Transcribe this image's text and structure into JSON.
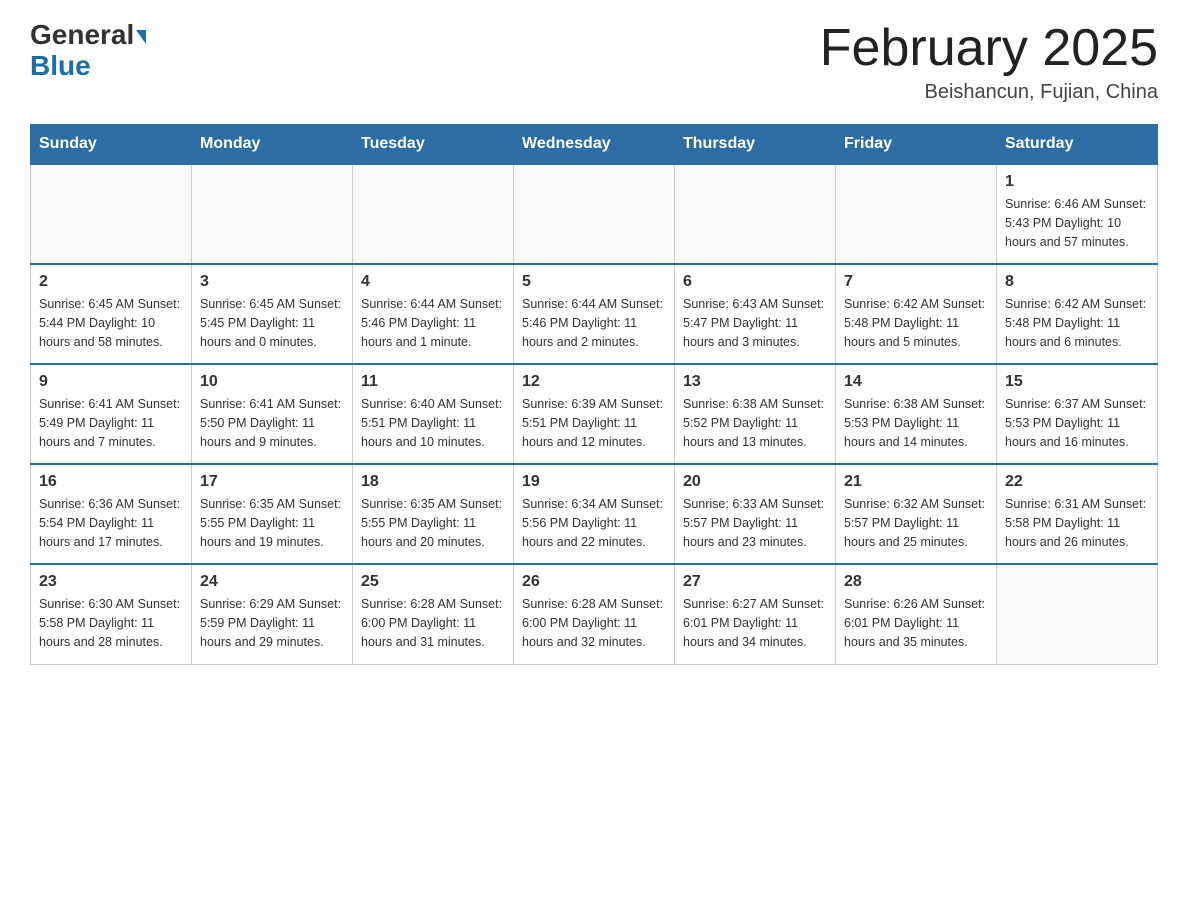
{
  "header": {
    "logo_line1": "General",
    "logo_line2": "Blue",
    "calendar_title": "February 2025",
    "location": "Beishancun, Fujian, China"
  },
  "days_of_week": [
    "Sunday",
    "Monday",
    "Tuesday",
    "Wednesday",
    "Thursday",
    "Friday",
    "Saturday"
  ],
  "weeks": [
    [
      {
        "day": "",
        "info": ""
      },
      {
        "day": "",
        "info": ""
      },
      {
        "day": "",
        "info": ""
      },
      {
        "day": "",
        "info": ""
      },
      {
        "day": "",
        "info": ""
      },
      {
        "day": "",
        "info": ""
      },
      {
        "day": "1",
        "info": "Sunrise: 6:46 AM\nSunset: 5:43 PM\nDaylight: 10 hours\nand 57 minutes."
      }
    ],
    [
      {
        "day": "2",
        "info": "Sunrise: 6:45 AM\nSunset: 5:44 PM\nDaylight: 10 hours\nand 58 minutes."
      },
      {
        "day": "3",
        "info": "Sunrise: 6:45 AM\nSunset: 5:45 PM\nDaylight: 11 hours\nand 0 minutes."
      },
      {
        "day": "4",
        "info": "Sunrise: 6:44 AM\nSunset: 5:46 PM\nDaylight: 11 hours\nand 1 minute."
      },
      {
        "day": "5",
        "info": "Sunrise: 6:44 AM\nSunset: 5:46 PM\nDaylight: 11 hours\nand 2 minutes."
      },
      {
        "day": "6",
        "info": "Sunrise: 6:43 AM\nSunset: 5:47 PM\nDaylight: 11 hours\nand 3 minutes."
      },
      {
        "day": "7",
        "info": "Sunrise: 6:42 AM\nSunset: 5:48 PM\nDaylight: 11 hours\nand 5 minutes."
      },
      {
        "day": "8",
        "info": "Sunrise: 6:42 AM\nSunset: 5:48 PM\nDaylight: 11 hours\nand 6 minutes."
      }
    ],
    [
      {
        "day": "9",
        "info": "Sunrise: 6:41 AM\nSunset: 5:49 PM\nDaylight: 11 hours\nand 7 minutes."
      },
      {
        "day": "10",
        "info": "Sunrise: 6:41 AM\nSunset: 5:50 PM\nDaylight: 11 hours\nand 9 minutes."
      },
      {
        "day": "11",
        "info": "Sunrise: 6:40 AM\nSunset: 5:51 PM\nDaylight: 11 hours\nand 10 minutes."
      },
      {
        "day": "12",
        "info": "Sunrise: 6:39 AM\nSunset: 5:51 PM\nDaylight: 11 hours\nand 12 minutes."
      },
      {
        "day": "13",
        "info": "Sunrise: 6:38 AM\nSunset: 5:52 PM\nDaylight: 11 hours\nand 13 minutes."
      },
      {
        "day": "14",
        "info": "Sunrise: 6:38 AM\nSunset: 5:53 PM\nDaylight: 11 hours\nand 14 minutes."
      },
      {
        "day": "15",
        "info": "Sunrise: 6:37 AM\nSunset: 5:53 PM\nDaylight: 11 hours\nand 16 minutes."
      }
    ],
    [
      {
        "day": "16",
        "info": "Sunrise: 6:36 AM\nSunset: 5:54 PM\nDaylight: 11 hours\nand 17 minutes."
      },
      {
        "day": "17",
        "info": "Sunrise: 6:35 AM\nSunset: 5:55 PM\nDaylight: 11 hours\nand 19 minutes."
      },
      {
        "day": "18",
        "info": "Sunrise: 6:35 AM\nSunset: 5:55 PM\nDaylight: 11 hours\nand 20 minutes."
      },
      {
        "day": "19",
        "info": "Sunrise: 6:34 AM\nSunset: 5:56 PM\nDaylight: 11 hours\nand 22 minutes."
      },
      {
        "day": "20",
        "info": "Sunrise: 6:33 AM\nSunset: 5:57 PM\nDaylight: 11 hours\nand 23 minutes."
      },
      {
        "day": "21",
        "info": "Sunrise: 6:32 AM\nSunset: 5:57 PM\nDaylight: 11 hours\nand 25 minutes."
      },
      {
        "day": "22",
        "info": "Sunrise: 6:31 AM\nSunset: 5:58 PM\nDaylight: 11 hours\nand 26 minutes."
      }
    ],
    [
      {
        "day": "23",
        "info": "Sunrise: 6:30 AM\nSunset: 5:58 PM\nDaylight: 11 hours\nand 28 minutes."
      },
      {
        "day": "24",
        "info": "Sunrise: 6:29 AM\nSunset: 5:59 PM\nDaylight: 11 hours\nand 29 minutes."
      },
      {
        "day": "25",
        "info": "Sunrise: 6:28 AM\nSunset: 6:00 PM\nDaylight: 11 hours\nand 31 minutes."
      },
      {
        "day": "26",
        "info": "Sunrise: 6:28 AM\nSunset: 6:00 PM\nDaylight: 11 hours\nand 32 minutes."
      },
      {
        "day": "27",
        "info": "Sunrise: 6:27 AM\nSunset: 6:01 PM\nDaylight: 11 hours\nand 34 minutes."
      },
      {
        "day": "28",
        "info": "Sunrise: 6:26 AM\nSunset: 6:01 PM\nDaylight: 11 hours\nand 35 minutes."
      },
      {
        "day": "",
        "info": ""
      }
    ]
  ]
}
